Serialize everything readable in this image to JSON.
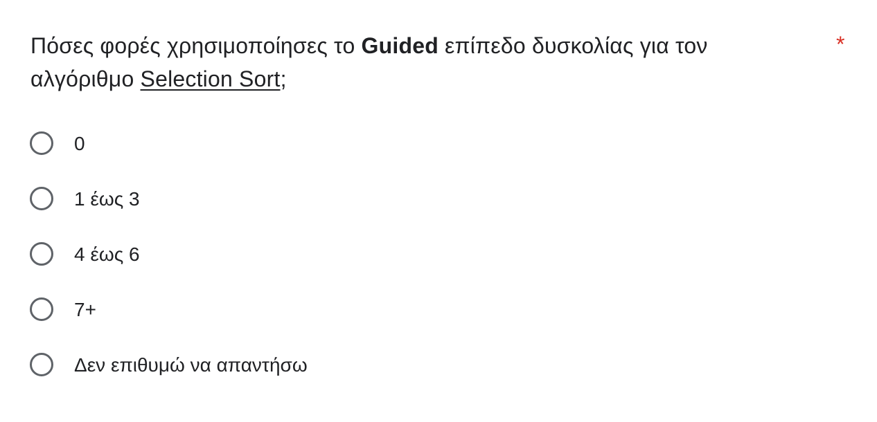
{
  "question": {
    "title_prefix": "Πόσες φορές χρησιμοποίησες το ",
    "title_bold": "Guided",
    "title_middle": " επίπεδο δυσκολίας για τον αλγόριθμο ",
    "title_underlined": "Selection Sort",
    "title_suffix": ";",
    "required_marker": "*"
  },
  "options": [
    {
      "label": "0"
    },
    {
      "label": "1 έως 3"
    },
    {
      "label": "4 έως 6"
    },
    {
      "label": "7+"
    },
    {
      "label": "Δεν επιθυμώ να απαντήσω"
    }
  ],
  "colors": {
    "required": "#d93025",
    "radio_border": "#5f6368",
    "text": "#202124"
  }
}
